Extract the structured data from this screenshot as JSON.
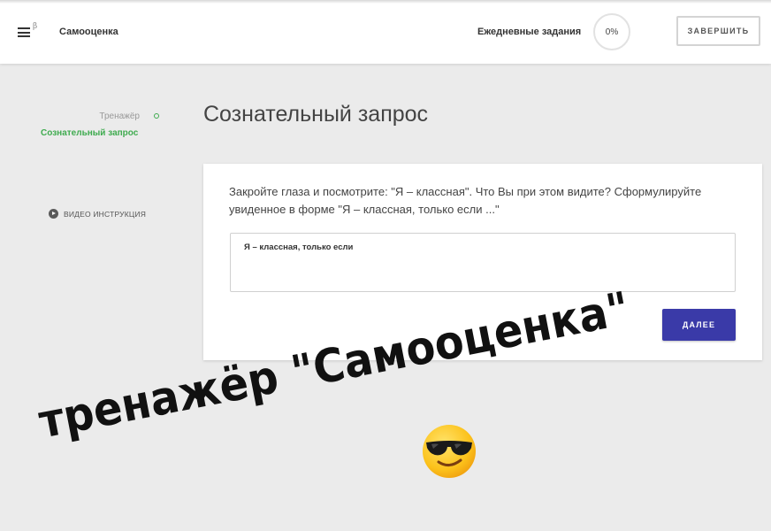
{
  "header": {
    "menu_icon": "hamburger-menu-icon",
    "beta": "β",
    "app_title": "Самооценка",
    "daily_tasks": "Ежедневные задания",
    "progress": "0%",
    "finish_label": "ЗАВЕРШИТЬ"
  },
  "sidebar": {
    "previous_step": "Тренажёр",
    "current_step": "Сознательный запрос",
    "video_instruction": "ВИДЕО ИНСТРУКЦИЯ",
    "video_icon": "play-circle-icon"
  },
  "main": {
    "title": "Сознательный запрос",
    "question": "Закройте глаза и посмотрите: \"Я – классная\". Что Вы при этом видите? Сформулируйте увиденное в форме \"Я – классная, только если ...\"",
    "answer_value": "Я – классная, только если",
    "next_label": "ДАЛЕЕ"
  },
  "overlay": {
    "caption": "тренажёр \"Самооценка\"",
    "emoji": "smiling-face-with-sunglasses"
  },
  "colors": {
    "accent_green": "#3fab4f",
    "button_blue": "#3a3aa8",
    "background": "#ebebeb"
  }
}
